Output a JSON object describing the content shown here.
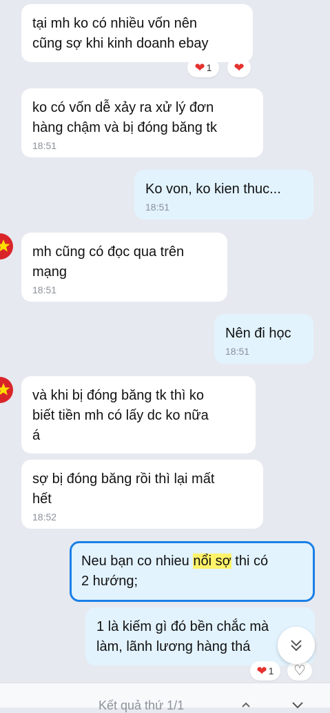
{
  "messages": [
    {
      "text": "tại mh ko có nhiều vốn nên\ncũng sợ khi kinh doanh ebay",
      "time": ""
    },
    {
      "text": "ko có vốn dễ xảy ra xử lý đơn\nhàng chậm và bị đóng băng tk",
      "time": "18:51"
    },
    {
      "text": "Ko von, ko kien thuc...",
      "time": "18:51"
    },
    {
      "text": "mh cũng có đọc qua trên\nmạng",
      "time": "18:51"
    },
    {
      "text": "Nên đi học",
      "time": "18:51"
    },
    {
      "text": "và khi bị đóng băng tk thì ko\nbiết tiền mh có lấy dc ko nữa\ná",
      "time": ""
    },
    {
      "text": "sợ bị đóng băng rồi thì lại mất\nhết",
      "time": "18:52"
    },
    {
      "text_before": "Neu bạn co nhieu ",
      "highlight": "nổi sợ",
      "text_after": " thi có\n2 hướng;",
      "time": ""
    },
    {
      "text": "1 là kiếm gì đó bền chắc mà\nlàm, lãnh lương hàng thá",
      "time": ""
    }
  ],
  "reactions": {
    "first": {
      "count": "1",
      "icon": "heart-icon"
    },
    "last": {
      "count": "1",
      "icon": "heart-icon"
    }
  },
  "icons": {
    "scroll": "chevron-double-down-icon",
    "avatar": "vietnam-flag-avatar"
  },
  "search_bar": {
    "result_text": "Kết quả thứ 1/1"
  },
  "colors": {
    "background": "#e6e9ef",
    "incoming": "#ffffff",
    "outgoing": "#e2f3fe",
    "selected_border": "#1a7fe6",
    "highlight": "#fff36a",
    "heart": "#e4322f"
  }
}
